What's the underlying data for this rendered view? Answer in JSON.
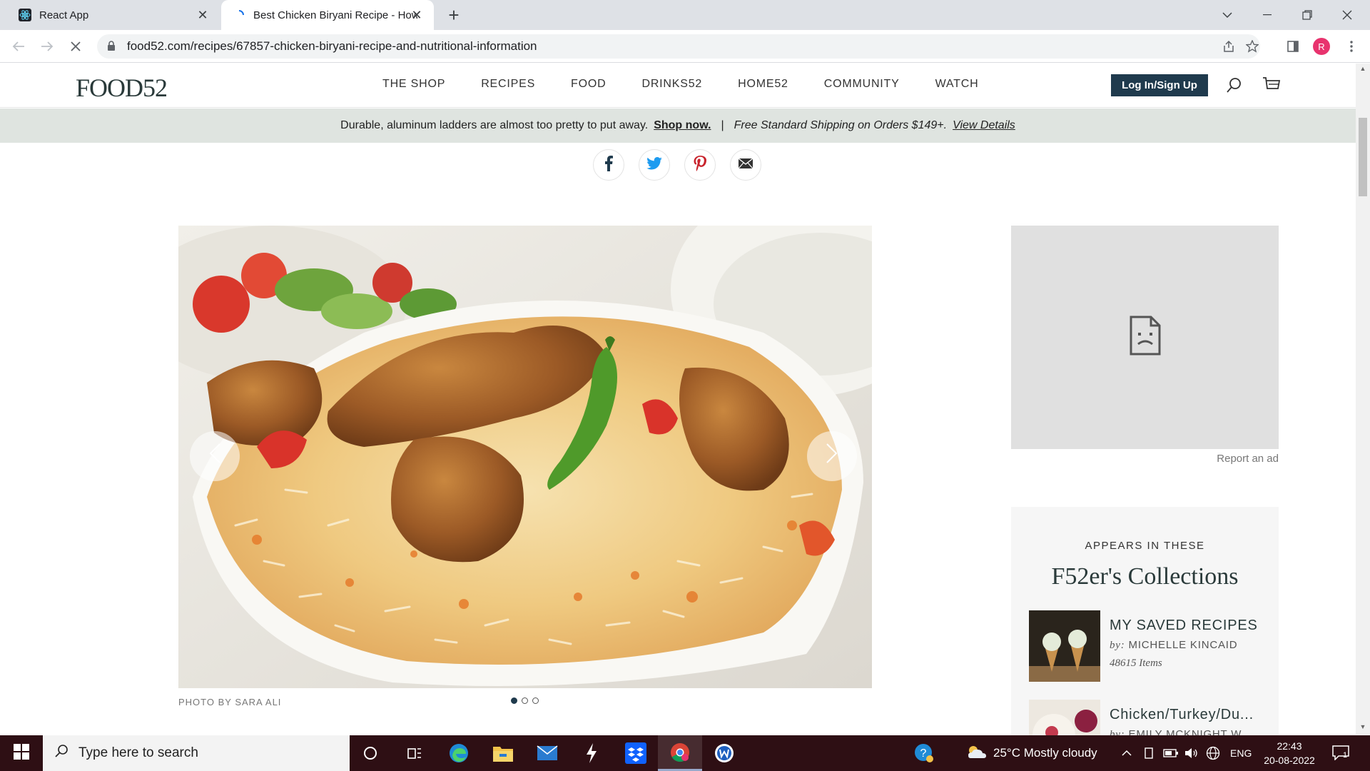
{
  "browser": {
    "tabs": [
      {
        "title": "React App",
        "close": "✕"
      },
      {
        "title": "Best Chicken Biryani Recipe - How",
        "close": "✕"
      }
    ],
    "new_tab": "+",
    "url": "food52.com/recipes/67857-chicken-biryani-recipe-and-nutritional-information",
    "profile_initial": "R"
  },
  "site": {
    "logo": "FOOD52",
    "nav": [
      "THE SHOP",
      "RECIPES",
      "FOOD",
      "DRINKS52",
      "HOME52",
      "COMMUNITY",
      "WATCH"
    ],
    "login_label": "Log In/Sign Up",
    "promo": {
      "text": "Durable, aluminum ladders are almost too pretty to put away.",
      "shop_link": "Shop now.",
      "separator": "|",
      "shipping": "Free Standard Shipping on Orders $149+.",
      "details_link": "View Details"
    }
  },
  "share": [
    "facebook-icon",
    "twitter-icon",
    "pinterest-icon",
    "email-icon"
  ],
  "hero": {
    "photo_credit": "PHOTO BY SARA ALI",
    "slides": 3,
    "active_slide": 1
  },
  "ad": {
    "report_label": "Report an ad"
  },
  "collections": {
    "eyebrow": "APPEARS IN THESE",
    "title": "F52er's Collections",
    "items": [
      {
        "name": "MY SAVED RECIPES",
        "by_label": "by:",
        "author": "MICHELLE KINCAID",
        "count": "48615 Items"
      },
      {
        "name": "Chicken/Turkey/Du...",
        "by_label": "by:",
        "author": "EMILY MCKNIGHT W...",
        "count": ""
      }
    ]
  },
  "taskbar": {
    "search_placeholder": "Type here to search",
    "weather": "25°C  Mostly cloudy",
    "language": "ENG",
    "time": "22:43",
    "date": "20-08-2022",
    "notifications": "1"
  },
  "colors": {
    "brand_navy": "#1f3a4d",
    "promo_bg": "#dfe4e0",
    "taskbar_bg": "#2e0f14"
  }
}
